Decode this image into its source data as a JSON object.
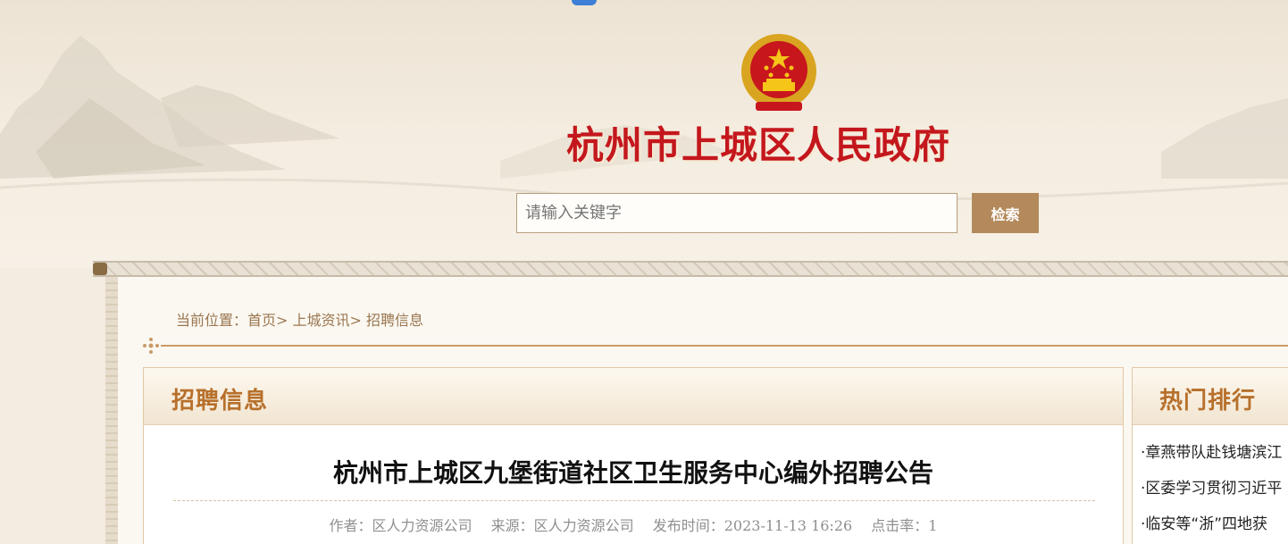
{
  "header": {
    "site_title": "杭州市上城区人民政府",
    "search_placeholder": "请输入关键字",
    "search_button": "检索"
  },
  "breadcrumb": {
    "label": "当前位置：",
    "items": [
      "首页",
      "上城资讯",
      "招聘信息"
    ],
    "separator": ">"
  },
  "main": {
    "section_title": "招聘信息",
    "article_title": "杭州市上城区九堡街道社区卫生服务中心编外招聘公告",
    "meta": {
      "author": "作者：区人力资源公司",
      "source": "来源：区人力资源公司",
      "published": "发布时间：2023-11-13 16:26",
      "clicks": "点击率：1"
    }
  },
  "sidebar": {
    "title": "热门排行",
    "items": [
      "·章燕带队赴钱塘滨江",
      "·区委学习贯彻习近平",
      "·临安等“浙”四地获"
    ]
  },
  "colors": {
    "title_red": "#c4171d",
    "accent_brown": "#b48a5c",
    "panel_title": "#b7702b"
  }
}
